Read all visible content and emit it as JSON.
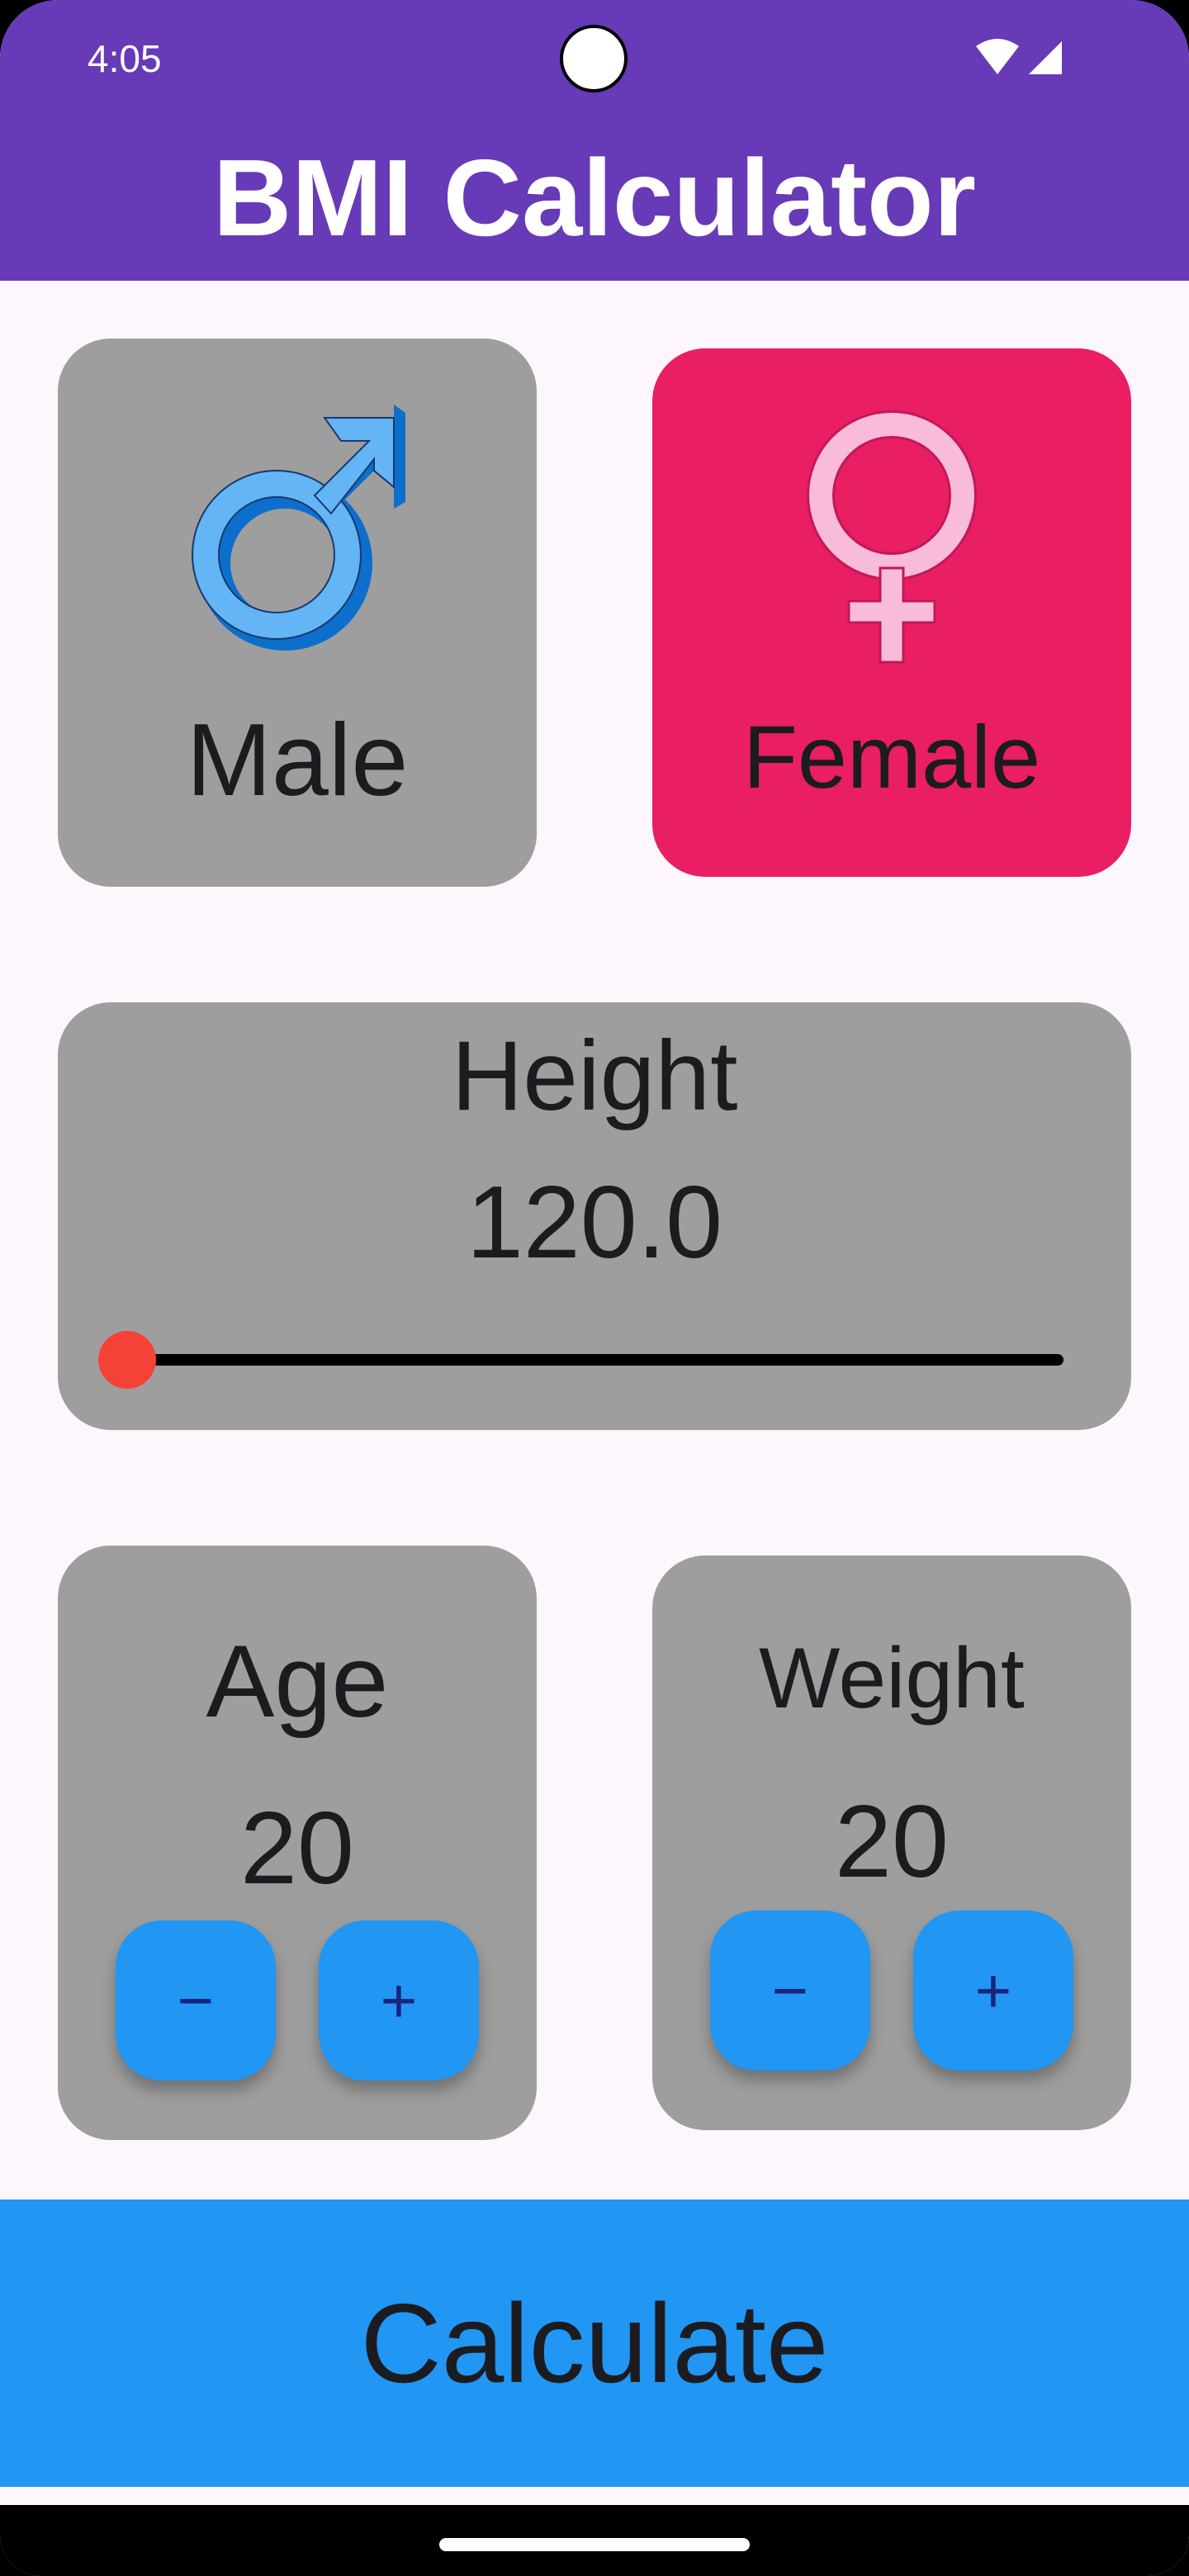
{
  "status_bar": {
    "time": "4:05",
    "icons": [
      "wifi-icon",
      "cellular-signal-icon"
    ]
  },
  "app_bar": {
    "title": "BMI Calculator",
    "color": "#673ab7"
  },
  "gender": {
    "male": {
      "label": "Male",
      "icon": "male-symbol-icon",
      "selected": false
    },
    "female": {
      "label": "Female",
      "icon": "female-symbol-icon",
      "selected": true
    },
    "selected_color": "#e91e63",
    "card_color": "#9e9e9e"
  },
  "height": {
    "label": "Height",
    "value": "120.0",
    "slider_fraction": 0.0
  },
  "age": {
    "label": "Age",
    "value": "20",
    "minus_label": "−",
    "plus_label": "+"
  },
  "weight": {
    "label": "Weight",
    "value": "20",
    "minus_label": "−",
    "plus_label": "+"
  },
  "calculate": {
    "label": "Calculate",
    "color": "#2196f3"
  }
}
